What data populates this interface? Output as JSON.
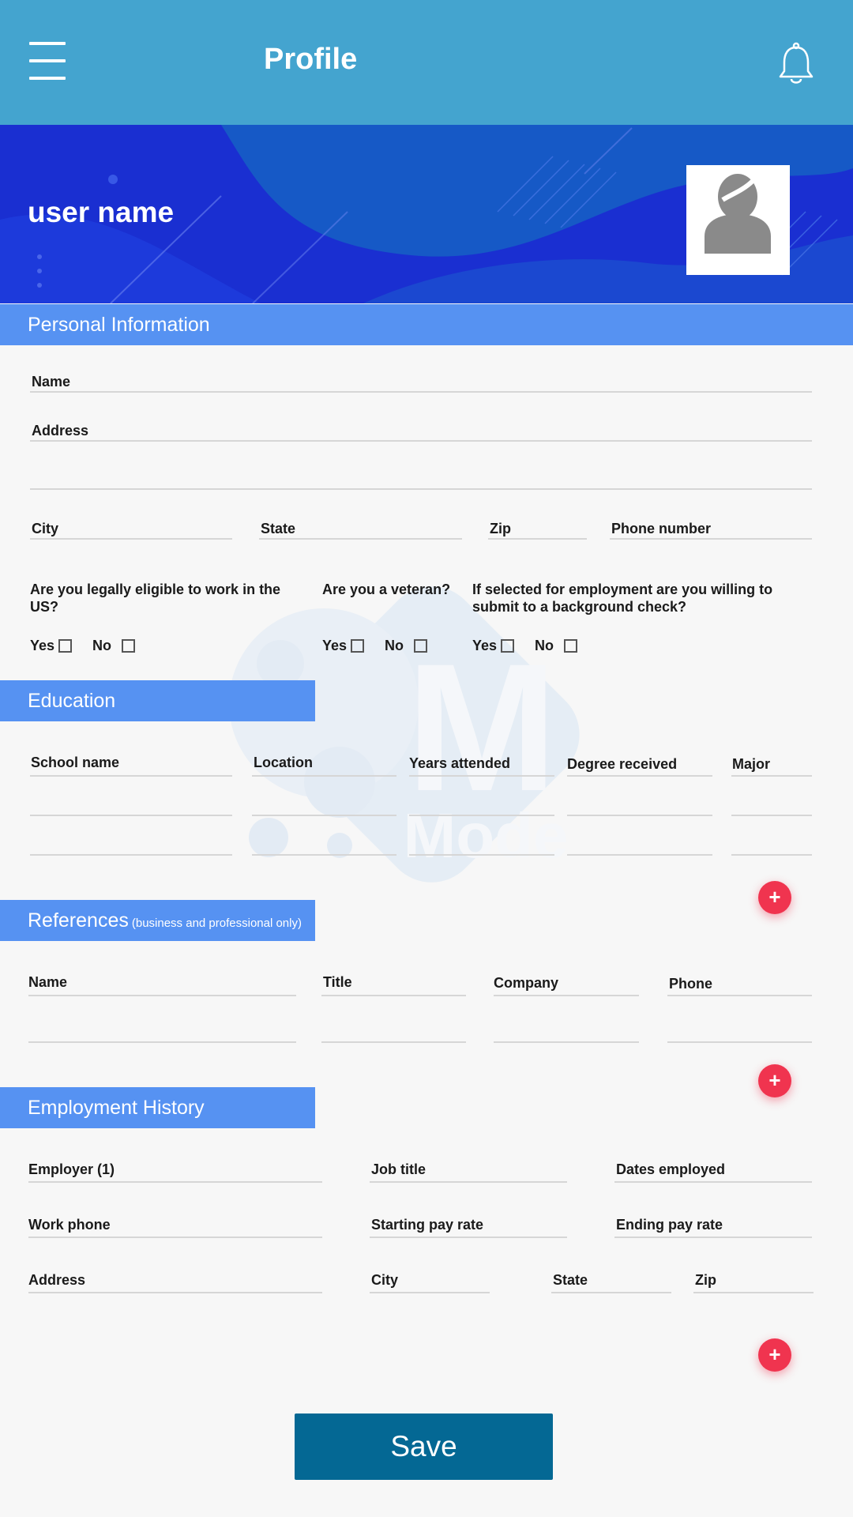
{
  "app_bar": {
    "title": "Profile"
  },
  "banner": {
    "user_name": "user name"
  },
  "personal": {
    "header": "Personal Information",
    "name_label": "Name",
    "address_label": "Address",
    "city_label": "City",
    "state_label": "State",
    "zip_label": "Zip",
    "phone_label": "Phone number",
    "q1": "Are you legally eligible to work in the US?",
    "q2": "Are you a veteran?",
    "q3": "If selected for employment are you willing to submit to a background check?",
    "yes": "Yes",
    "no": "No"
  },
  "education": {
    "header": "Education",
    "columns": [
      "School name",
      "Location",
      "Years attended",
      "Degree received",
      "Major"
    ]
  },
  "references": {
    "header": "References",
    "header_note": "(business and professional only)",
    "columns": [
      "Name",
      "Title",
      "Company",
      "Phone"
    ]
  },
  "employment": {
    "header": "Employment History",
    "employer_label": "Employer (1)",
    "job_title_label": "Job title",
    "dates_label": "Dates employed",
    "work_phone_label": "Work phone",
    "start_pay_label": "Starting pay rate",
    "end_pay_label": "Ending pay rate",
    "address_label": "Address",
    "city_label": "City",
    "state_label": "State",
    "zip_label": "Zip"
  },
  "add_symbol": "+",
  "save_label": "Save",
  "watermark_text": "Mode",
  "colors": {
    "app_bar": "#44a4cf",
    "section": "#5692f2",
    "save": "#046894",
    "add": "#f0344f",
    "banner": "#1a2fd1"
  },
  "icons": [
    "menu-icon",
    "bell-icon",
    "user-avatar-icon",
    "plus-icon"
  ]
}
